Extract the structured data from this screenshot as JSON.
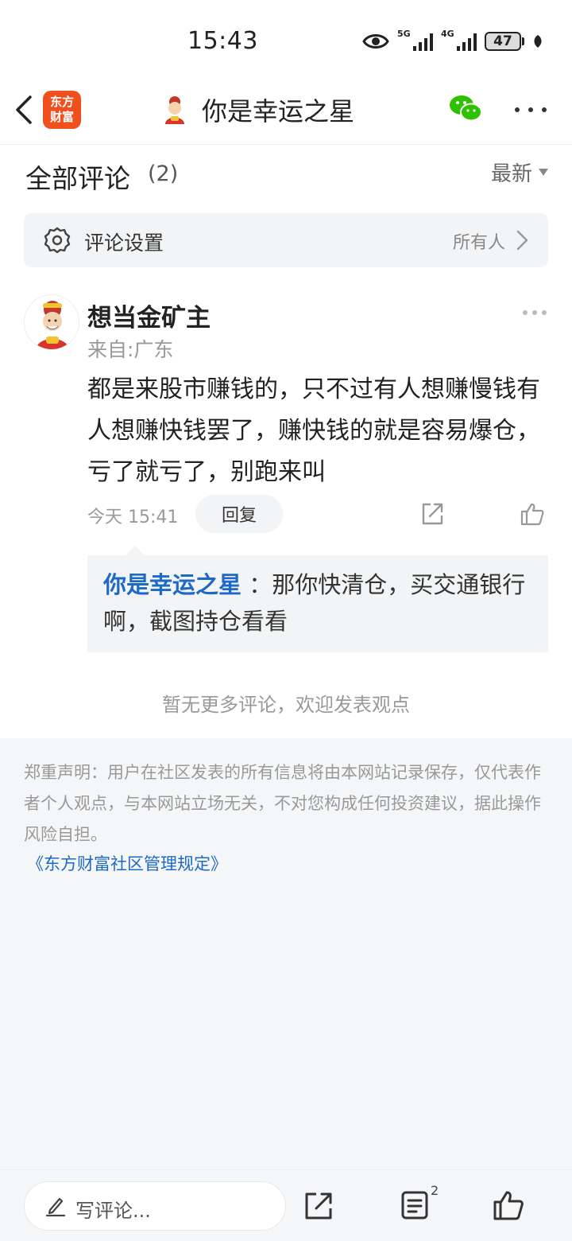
{
  "status_bar": {
    "time": "15:43",
    "signal_1": "5G",
    "signal_2": "4G",
    "battery": "47"
  },
  "header": {
    "back_icon": "chevron-left-icon",
    "brand_logo_line1": "东方",
    "brand_logo_line2": "财富",
    "title": "你是幸运之星",
    "share_icon": "wechat-icon",
    "more_icon": "more-horizontal-icon"
  },
  "comments": {
    "title": "全部评论",
    "count": "(2)",
    "sort_label": "最新",
    "settings_label": "评论设置",
    "settings_value": "所有人"
  },
  "comment": {
    "user": "想当金矿主",
    "origin": "来自:广东",
    "text": "都是来股市赚钱的，只不过有人想赚慢钱有人想赚快钱罢了，赚快钱的就是容易爆仓，亏了就亏了，别跑来叫",
    "time": "今天 15:41",
    "reply_label": "回复",
    "reply": {
      "author": "你是幸运之星",
      "separator": " ：",
      "text": "那你快清仓，买交通银行啊，截图持仓看看"
    }
  },
  "no_more_text": "暂无更多评论，欢迎发表观点",
  "disclaimer": {
    "text": "郑重声明：用户在社区发表的所有信息将由本网站记录保存，仅代表作者个人观点，与本网站立场无关，不对您构成任何投资建议，据此操作风险自担。",
    "rules_link": "《东方财富社区管理规定》"
  },
  "bottom_bar": {
    "input_placeholder": "写评论...",
    "comment_badge": "2"
  },
  "colors": {
    "brand": "#f0501e",
    "link": "#1c69c6",
    "wechat": "#2dc100"
  }
}
